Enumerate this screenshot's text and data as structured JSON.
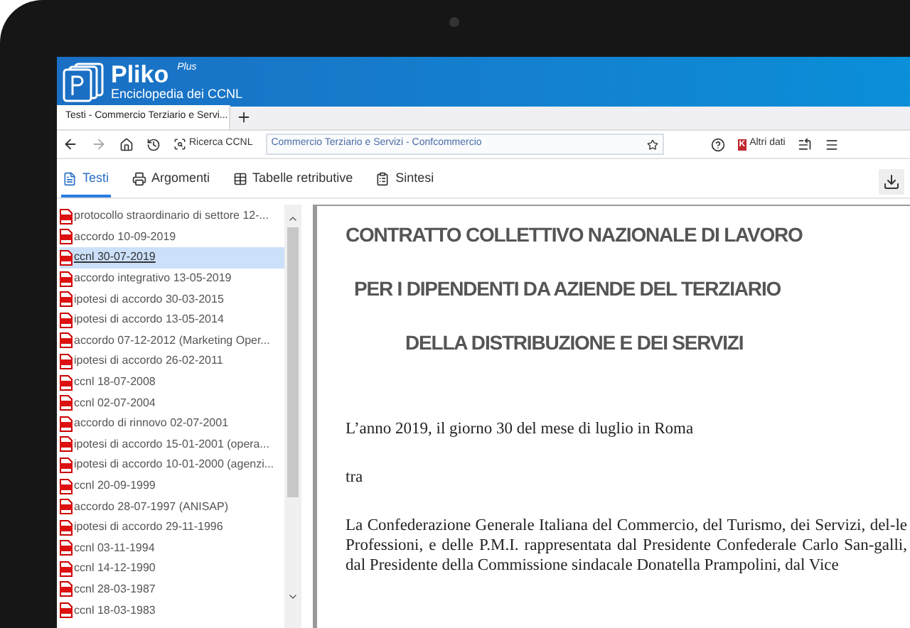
{
  "app": {
    "name": "Pliko",
    "edition": "Plus",
    "subtitle": "Enciclopedia dei CCNL"
  },
  "browser_tab": {
    "title": "Testi - Commercio Terziario e Servi..."
  },
  "toolbar": {
    "search_label": "Ricerca CCNL",
    "address": "Commercio Terziario e Servizi - Confcommercio",
    "extra_logo": "K",
    "extra_label": "Altri dati"
  },
  "tabs": [
    {
      "label": "Testi",
      "selected": true
    },
    {
      "label": "Argomenti",
      "selected": false
    },
    {
      "label": "Tabelle retributive",
      "selected": false
    },
    {
      "label": "Sintesi",
      "selected": false
    }
  ],
  "documents": [
    {
      "label": "protocollo straordinario di settore 12-...",
      "selected": false
    },
    {
      "label": "accordo 10-09-2019",
      "selected": false
    },
    {
      "label": "ccnl 30-07-2019",
      "selected": true
    },
    {
      "label": "accordo integrativo 13-05-2019",
      "selected": false
    },
    {
      "label": "ipotesi di accordo 30-03-2015",
      "selected": false
    },
    {
      "label": "ipotesi di accordo 13-05-2014",
      "selected": false
    },
    {
      "label": "accordo 07-12-2012 (Marketing Oper...",
      "selected": false
    },
    {
      "label": "ipotesi di accordo 26-02-2011",
      "selected": false
    },
    {
      "label": "ccnl 18-07-2008",
      "selected": false
    },
    {
      "label": "ccnl 02-07-2004",
      "selected": false
    },
    {
      "label": "accordo di rinnovo 02-07-2001",
      "selected": false
    },
    {
      "label": "ipotesi di accordo 15-01-2001 (opera...",
      "selected": false
    },
    {
      "label": "ipotesi di accordo 10-01-2000 (agenzi...",
      "selected": false
    },
    {
      "label": "ccnl 20-09-1999",
      "selected": false
    },
    {
      "label": "accordo 28-07-1997 (ANISAP)",
      "selected": false
    },
    {
      "label": "ipotesi di accordo 29-11-1996",
      "selected": false
    },
    {
      "label": "ccnl 03-11-1994",
      "selected": false
    },
    {
      "label": "ccnl 14-12-1990",
      "selected": false
    },
    {
      "label": "ccnl 28-03-1987",
      "selected": false
    },
    {
      "label": "ccnl 18-03-1983",
      "selected": false
    }
  ],
  "document": {
    "headings": [
      "CONTRATTO COLLETTIVO NAZIONALE DI LAVORO",
      "PER I DIPENDENTI DA AZIENDE DEL TERZIARIO",
      "DELLA DISTRIBUZIONE E DEI SERVIZI"
    ],
    "paragraphs": [
      "L’anno 2019, il giorno 30 del mese di luglio in Roma",
      "tra",
      "La Confederazione Generale Italiana del Commercio, del Turismo, dei Servizi, del-le Professioni, e delle P.M.I. rappresentata dal Presidente Confederale Carlo San-galli, dal Presidente della Commissione sindacale Donatella Prampolini, dal Vice"
    ]
  }
}
